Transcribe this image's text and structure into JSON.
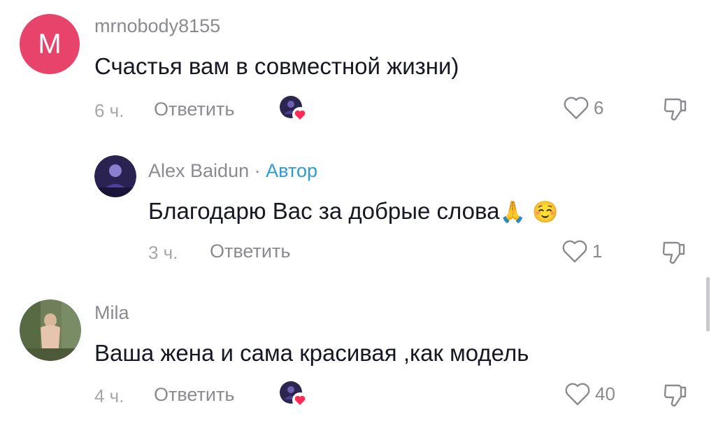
{
  "comments": [
    {
      "username": "mrnobody8155",
      "avatar_letter": "M",
      "avatar_color": "#e8436a",
      "text": "Счастья вам в совместной жизни)",
      "time": "6 ч.",
      "reply_label": "Ответить",
      "likes": "6",
      "liked_by_author": true
    },
    {
      "username": "Alex Baidun",
      "separator": "·",
      "author_badge": "Автор",
      "text": "Благодарю Вас за добрые слова",
      "emojis": "🙏 ☺️",
      "time": "3 ч.",
      "reply_label": "Ответить",
      "likes": "1",
      "is_reply": true
    },
    {
      "username": "Mila",
      "text": "Ваша жена и сама красивая ,как модель",
      "time": "4 ч.",
      "reply_label": "Ответить",
      "likes": "40",
      "liked_by_author": true
    }
  ],
  "icons": {
    "like": "heart-outline-icon",
    "dislike": "thumbs-down-outline-icon",
    "liked_by_creator": "creator-heart-badge-icon"
  },
  "colors": {
    "heart_badge": "#fe2c55",
    "author_badge": "#2f9bd6",
    "avatar_m": "#e8436a"
  }
}
